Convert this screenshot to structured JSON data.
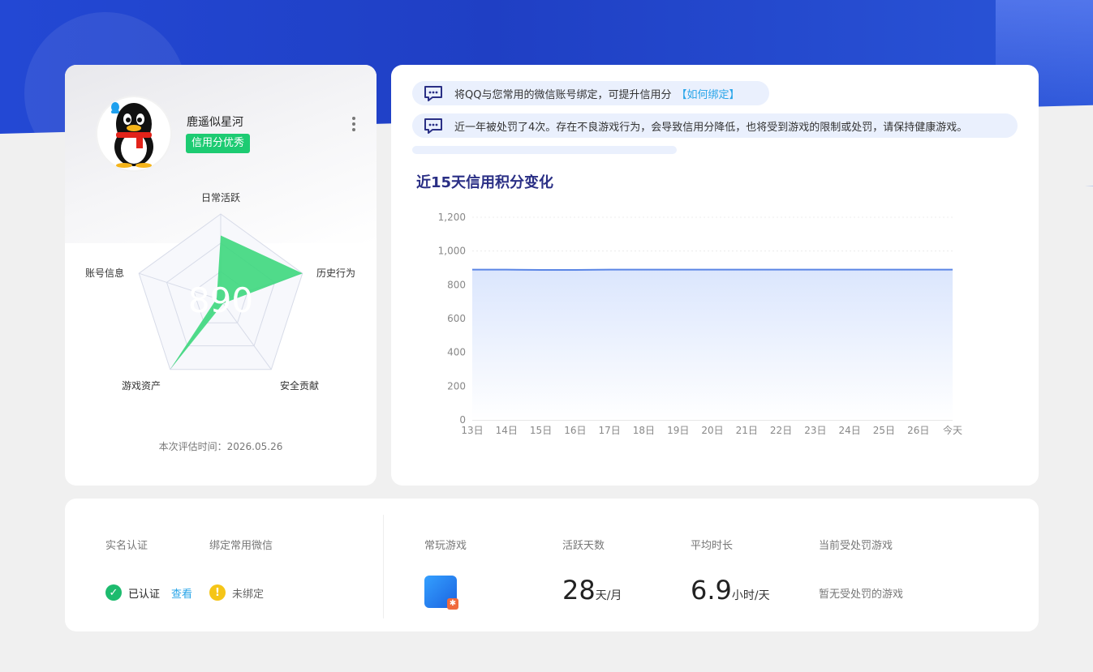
{
  "profile": {
    "nickname": "鹿遥似星河",
    "credit_level": "信用分优秀",
    "score": "890",
    "eval_time": "本次评估时间：2026.05.26",
    "radar": {
      "axes": [
        "日常活跃",
        "历史行为",
        "安全贡献",
        "游戏资产",
        "账号信息"
      ],
      "values": [
        0.75,
        1.0,
        0.05,
        1.0,
        0.05
      ],
      "fill": "#3dd77d"
    }
  },
  "notices": [
    {
      "text": "将QQ与您常用的微信账号绑定，可提升信用分",
      "link": "【如何绑定】"
    },
    {
      "text": "近一年被处罚了4次。存在不良游戏行为，会导致信用分降低，也将受到游戏的限制或处罚，请保持健康游戏。",
      "link": ""
    }
  ],
  "chart": {
    "title": "近15天信用积分变化"
  },
  "chart_data": {
    "type": "area",
    "title": "近15天信用积分变化",
    "x": [
      "13日",
      "14日",
      "15日",
      "16日",
      "17日",
      "18日",
      "19日",
      "20日",
      "21日",
      "22日",
      "23日",
      "24日",
      "25日",
      "26日",
      "今天"
    ],
    "values": [
      890,
      890,
      888,
      888,
      890,
      890,
      890,
      890,
      890,
      890,
      890,
      890,
      890,
      890,
      890
    ],
    "ylim": [
      0,
      1200
    ],
    "yticks": [
      "0",
      "200",
      "400",
      "600",
      "800",
      "1,000",
      "1,200"
    ],
    "xlabel": "",
    "ylabel": "",
    "grid": true,
    "line_color": "#5b86e5",
    "fill_color": "#dbe6fd"
  },
  "stats": {
    "labels": {
      "real_name": "实名认证",
      "wechat": "绑定常用微信",
      "common_games": "常玩游戏",
      "active_days": "活跃天数",
      "avg_duration": "平均时长",
      "penalty_games": "当前受处罚游戏"
    },
    "real_name_status": "已认证",
    "real_name_view": "查看",
    "wechat_status": "未绑定",
    "active_days_value": "28",
    "active_days_unit": "天/月",
    "avg_duration_value": "6.9",
    "avg_duration_unit": "小时/天",
    "penalty_text": "暂无受处罚的游戏"
  }
}
